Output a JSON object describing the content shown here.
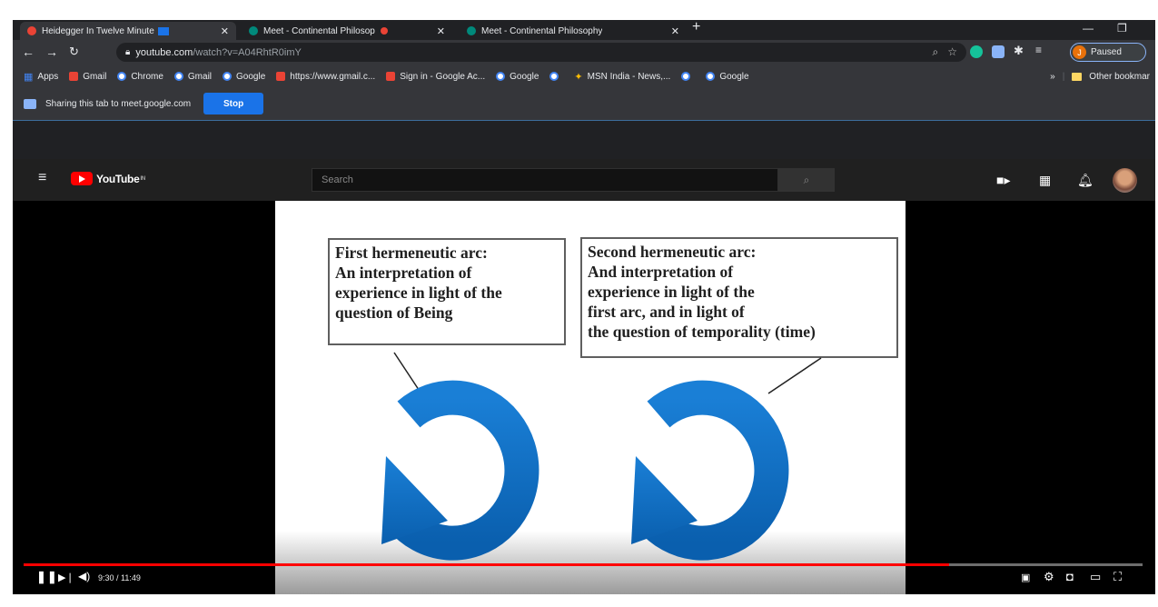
{
  "tabs": [
    {
      "title": "Heidegger In Twelve Minute",
      "favicon_color": "#ea4335",
      "active": true
    },
    {
      "title": "Meet - Continental Philosop",
      "favicon_color": "#00897b",
      "active": false
    },
    {
      "title": "Meet - Continental Philosophy",
      "favicon_color": "#00897b",
      "active": false
    }
  ],
  "url": {
    "host": "youtube.com",
    "path": "/watch?v=A04RhtR0imY"
  },
  "profile": {
    "initial": "J",
    "status": "Paused"
  },
  "bookmarks": [
    {
      "label": "Apps",
      "icon": "apps-icon"
    },
    {
      "label": "Gmail",
      "icon": "gmail-icon"
    },
    {
      "label": "Chrome",
      "icon": "google-icon"
    },
    {
      "label": "Gmail",
      "icon": "google-icon"
    },
    {
      "label": "Google",
      "icon": "google-icon"
    },
    {
      "label": "https://www.gmail.c...",
      "icon": "gmail-icon"
    },
    {
      "label": "Sign in - Google Ac...",
      "icon": "gmail-icon"
    },
    {
      "label": "Google",
      "icon": "google-icon"
    },
    {
      "label": "",
      "icon": "google-icon"
    },
    {
      "label": "MSN India - News,...",
      "icon": "msn-icon"
    },
    {
      "label": "",
      "icon": "google-icon"
    },
    {
      "label": "Google",
      "icon": "google-icon"
    }
  ],
  "other_bookmarks": "Other bookmar",
  "sharing": {
    "text": "Sharing this tab to meet.google.com",
    "stop": "Stop"
  },
  "youtube": {
    "logo": "YouTube",
    "country": "IN",
    "search_placeholder": "Search"
  },
  "slide": {
    "box1": "First hermeneutic arc:\nAn interpretation of\nexperience in light of the\nquestion of Being",
    "box2": "Second hermeneutic arc:\nAnd interpretation of\nexperience in light of the\nfirst arc, and in light of\nthe question of temporality (time)"
  },
  "player": {
    "time": "9:30 / 11:49",
    "progress": 0.827
  },
  "colors": {
    "arc_blue": "#0a6cc4",
    "progress_red": "#ff0000"
  }
}
